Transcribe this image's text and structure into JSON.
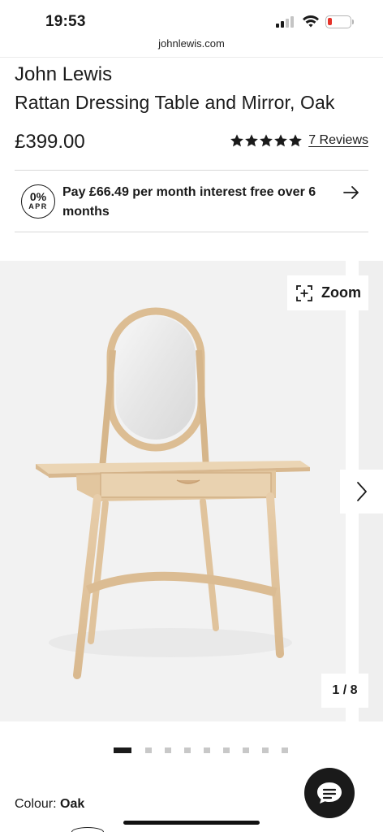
{
  "status_bar": {
    "time": "19:53",
    "signal_icon": "cellular-signal-icon",
    "wifi_icon": "wifi-icon",
    "battery_icon": "battery-low-icon",
    "battery_color": "#e5332a"
  },
  "browser": {
    "url": "johnlewis.com"
  },
  "product": {
    "brand": "John Lewis",
    "name": "Rattan Dressing Table and Mirror, Oak",
    "price": "£399.00",
    "rating": {
      "stars": 5,
      "max": 5,
      "reviews_label": "7 Reviews"
    }
  },
  "finance": {
    "badge_percent": "0%",
    "badge_label": "APR",
    "text": "Pay £66.49 per month interest free over 6 months",
    "arrow_icon": "arrow-right-icon"
  },
  "gallery": {
    "zoom_label": "Zoom",
    "zoom_icon": "zoom-expand-icon",
    "next_icon": "chevron-right-icon",
    "counter": "1 / 8",
    "current_index": 1,
    "total": 8,
    "dot_count": 9
  },
  "colour": {
    "label": "Colour:",
    "value": "Oak"
  },
  "chat": {
    "icon": "chat-bubble-icon",
    "color": "#1a1a1a"
  }
}
